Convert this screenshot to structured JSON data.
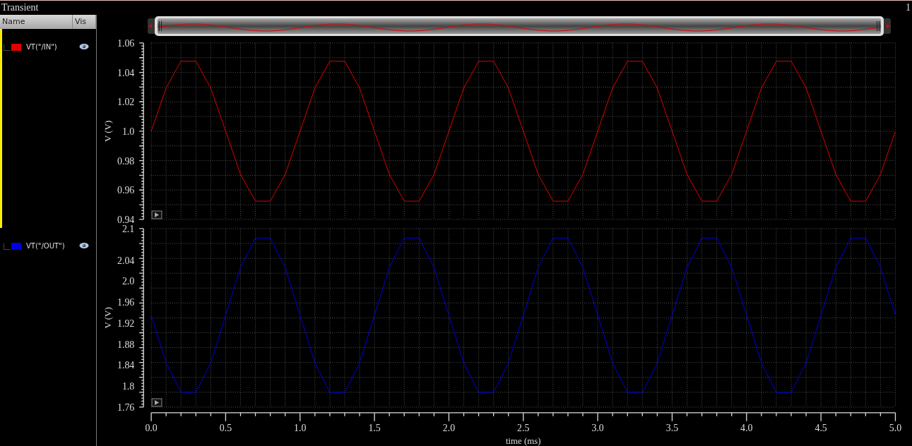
{
  "window": {
    "title": "Transient",
    "badge": "1"
  },
  "signal_list": {
    "columns": [
      "Name",
      "Vis"
    ],
    "traces": [
      {
        "name": "VT(\"/IN\")",
        "color": "#e00000",
        "selected": true,
        "visible": true
      },
      {
        "name": "VT(\"/OUT\")",
        "color": "#0000e0",
        "selected": false,
        "visible": true
      }
    ]
  },
  "charts": [
    {
      "chart_data": {
        "type": "line",
        "ylabel": "V (V)",
        "x": [
          0,
          0.1,
          0.2,
          0.3,
          0.4,
          0.5,
          0.6,
          0.7,
          0.8,
          0.9,
          1,
          1.1,
          1.2,
          1.3,
          1.4,
          1.5,
          1.6,
          1.7,
          1.8,
          1.9,
          2,
          2.1,
          2.2,
          2.3,
          2.4,
          2.5,
          2.6,
          2.7,
          2.8,
          2.9,
          3,
          3.1,
          3.2,
          3.3,
          3.4,
          3.5,
          3.6,
          3.7,
          3.8,
          3.9,
          4,
          4.1,
          4.2,
          4.3,
          4.4,
          4.5,
          4.6,
          4.7,
          4.8,
          4.9,
          5
        ],
        "grid": true,
        "series": [
          {
            "color": "#e00000",
            "values": [
              1.0,
              1.0294,
              1.0476,
              1.0476,
              1.0294,
              1.0,
              0.9706,
              0.9524,
              0.9524,
              0.9706,
              1.0,
              1.0294,
              1.0476,
              1.0476,
              1.0294,
              1.0,
              0.9706,
              0.9524,
              0.9524,
              0.9706,
              1.0,
              1.0294,
              1.0476,
              1.0476,
              1.0294,
              1.0,
              0.9706,
              0.9524,
              0.9524,
              0.9706,
              1.0,
              1.0294,
              1.0476,
              1.0476,
              1.0294,
              1.0,
              0.9706,
              0.9524,
              0.9524,
              0.9706,
              1.0,
              1.0294,
              1.0476,
              1.0476,
              1.0294,
              1.0,
              0.9706,
              0.9524,
              0.9524,
              0.9706,
              1.0
            ]
          }
        ],
        "xlim": [
          0,
          5
        ],
        "ylim": [
          0.94,
          1.06
        ],
        "yticks": [
          {
            "value": 0.94,
            "label": "0.94"
          },
          {
            "value": 0.96,
            "label": "0.96"
          },
          {
            "value": 0.98,
            "label": "0.98"
          },
          {
            "value": 1.0,
            "label": "1.0"
          },
          {
            "value": 1.02,
            "label": "1.02"
          },
          {
            "value": 1.04,
            "label": "1.04"
          },
          {
            "value": 1.06,
            "label": "1.06"
          }
        ]
      }
    },
    {
      "chart_data": {
        "type": "line",
        "xlabel": "time (ms)",
        "ylabel": "V (V)",
        "x": [
          0,
          0.1,
          0.2,
          0.3,
          0.4,
          0.5,
          0.6,
          0.7,
          0.8,
          0.9,
          1,
          1.1,
          1.2,
          1.3,
          1.4,
          1.5,
          1.6,
          1.7,
          1.8,
          1.9,
          2,
          2.1,
          2.2,
          2.3,
          2.4,
          2.5,
          2.6,
          2.7,
          2.8,
          2.9,
          3,
          3.1,
          3.2,
          3.3,
          3.4,
          3.5,
          3.6,
          3.7,
          3.8,
          3.9,
          4,
          4.1,
          4.2,
          4.3,
          4.4,
          4.5,
          4.6,
          4.7,
          4.8,
          4.9,
          5
        ],
        "grid": true,
        "series": [
          {
            "color": "#0000e0",
            "values": [
              1.935,
              1.844,
              1.788,
              1.788,
              1.844,
              1.935,
              2.026,
              2.082,
              2.082,
              2.026,
              1.935,
              1.844,
              1.788,
              1.788,
              1.844,
              1.935,
              2.026,
              2.082,
              2.082,
              2.026,
              1.935,
              1.844,
              1.788,
              1.788,
              1.844,
              1.935,
              2.026,
              2.082,
              2.082,
              2.026,
              1.935,
              1.844,
              1.788,
              1.788,
              1.844,
              1.935,
              2.026,
              2.082,
              2.082,
              2.026,
              1.935,
              1.844,
              1.788,
              1.788,
              1.844,
              1.935,
              2.026,
              2.082,
              2.082,
              2.026,
              1.935
            ]
          }
        ],
        "xlim": [
          0,
          5
        ],
        "ylim": [
          1.76,
          2.1
        ],
        "xticks": [
          {
            "value": 0,
            "label": "0.0"
          },
          {
            "value": 0.5,
            "label": "0.5"
          },
          {
            "value": 1,
            "label": "1.0"
          },
          {
            "value": 1.5,
            "label": "1.5"
          },
          {
            "value": 2,
            "label": "2.0"
          },
          {
            "value": 2.5,
            "label": "2.5"
          },
          {
            "value": 3,
            "label": "3.0"
          },
          {
            "value": 3.5,
            "label": "3.5"
          },
          {
            "value": 4,
            "label": "4.0"
          },
          {
            "value": 4.5,
            "label": "4.5"
          },
          {
            "value": 5,
            "label": "5.0"
          }
        ],
        "yticks": [
          {
            "value": 1.76,
            "label": "1.76"
          },
          {
            "value": 1.8,
            "label": "1.8"
          },
          {
            "value": 1.84,
            "label": "1.84"
          },
          {
            "value": 1.88,
            "label": "1.88"
          },
          {
            "value": 1.92,
            "label": "1.92"
          },
          {
            "value": 1.96,
            "label": "1.96"
          },
          {
            "value": 2.0,
            "label": "2.0"
          },
          {
            "value": 2.04,
            "label": "2.04"
          },
          {
            "value": 2.1,
            "label": "2.1"
          }
        ]
      }
    }
  ]
}
